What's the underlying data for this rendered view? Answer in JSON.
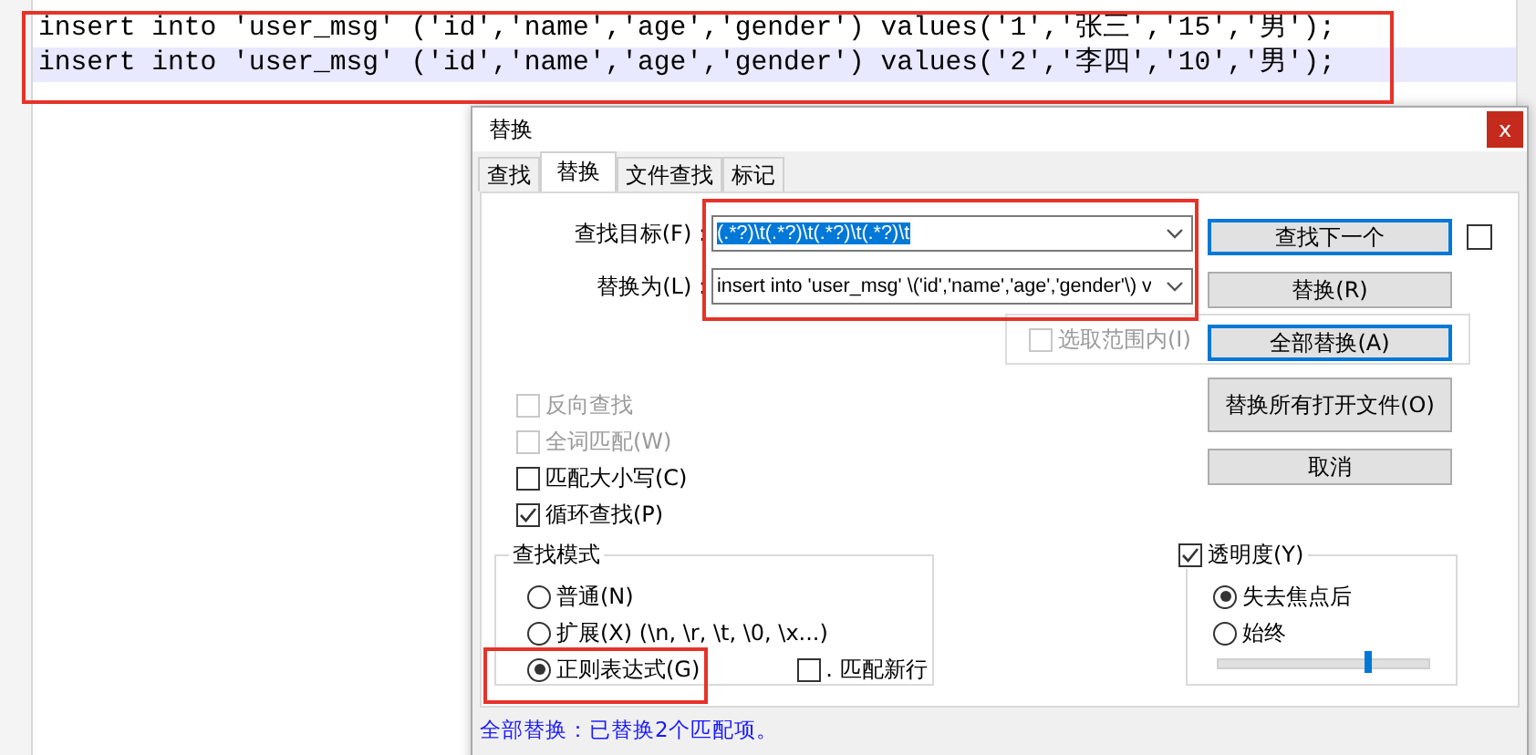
{
  "editor": {
    "lines": [
      {
        "text": "insert into 'user_msg' ('id','name','age','gender') values('1','张三','15','男');",
        "current": false
      },
      {
        "text": "insert into 'user_msg' ('id','name','age','gender') values('2','李四','10','男');",
        "current": true
      }
    ]
  },
  "dialog": {
    "title": "替换",
    "close": "x",
    "tabs": [
      {
        "label": "查找",
        "selected": false
      },
      {
        "label": "替换",
        "selected": true
      },
      {
        "label": "文件查找",
        "selected": false
      },
      {
        "label": "标记",
        "selected": false
      }
    ],
    "fields": [
      {
        "label": "查找目标(F) :",
        "value": "(.*?)\\t(.*?)\\t(.*?)\\t(.*?)\\t",
        "text_selected": true
      },
      {
        "label": "替换为(L) :",
        "value": "insert into 'user_msg' \\('id','name','age','gender'\\) v",
        "text_selected": false
      }
    ],
    "pin_checkbox": {
      "checked": false
    },
    "in_selection": {
      "label": "选取范围内(I)",
      "checked": false,
      "disabled": true
    },
    "buttons": [
      {
        "label": "查找下一个",
        "default": true
      },
      {
        "label": "替换(R)",
        "default": false
      },
      {
        "label": "全部替换(A)",
        "default": true
      },
      {
        "label": "替换所有打开文件(O)",
        "default": false
      },
      {
        "label": "取消",
        "default": false
      }
    ],
    "options": [
      {
        "label": "反向查找",
        "checked": false,
        "disabled": true
      },
      {
        "label": "全词匹配(W)",
        "checked": false,
        "disabled": true
      },
      {
        "label": "匹配大小写(C)",
        "checked": false,
        "disabled": false
      },
      {
        "label": "循环查找(P)",
        "checked": true,
        "disabled": false
      }
    ],
    "search_mode": {
      "title": "查找模式",
      "options": [
        {
          "label": "普通(N)",
          "selected": false
        },
        {
          "label": "扩展(X) (\\n, \\r, \\t, \\0, \\x...)",
          "selected": false
        },
        {
          "label": "正则表达式(G)",
          "selected": true
        }
      ],
      "newline": {
        "label": ". 匹配新行",
        "checked": false
      }
    },
    "transparency": {
      "label": "透明度(Y)",
      "checked": true,
      "options": [
        {
          "label": "失去焦点后",
          "selected": true
        },
        {
          "label": "始终",
          "selected": false
        }
      ],
      "level": 0.71
    },
    "status": "全部替换：已替换2个匹配项。"
  }
}
